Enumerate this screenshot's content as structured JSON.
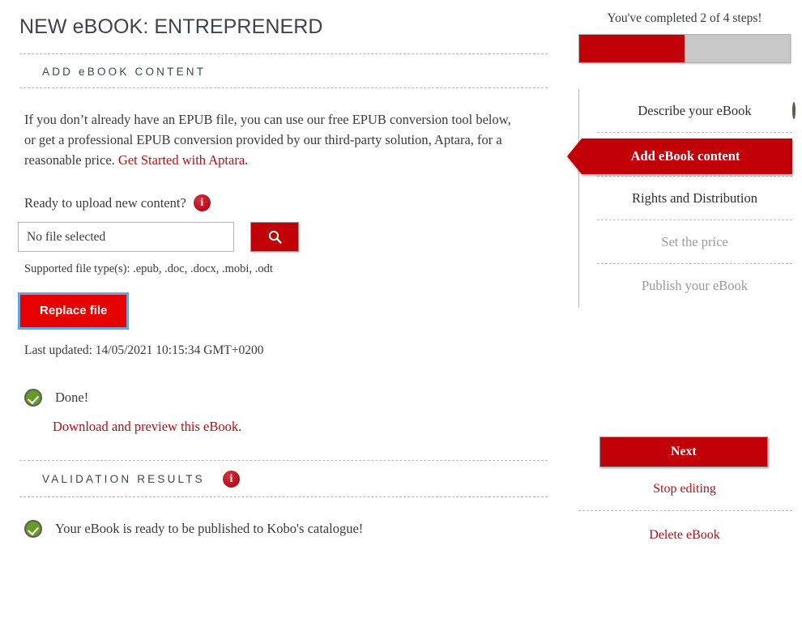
{
  "page": {
    "title": "NEW eBOOK: ENTREPRENERD"
  },
  "content_section": {
    "heading": "ADD eBOOK CONTENT",
    "intro_text_part1": "If you don’t already have an EPUB file, you can use our free EPUB conversion tool below, or get a professional EPUB conversion provided by our third-party solution, Aptara, for a reasonable price. ",
    "aptara_link": "Get Started with Aptara.",
    "upload_label": "Ready to upload new content?",
    "upload_info_icon": "info-icon",
    "file_input_value": "No file selected",
    "file_input_placeholder": "No file selected",
    "browse_icon": "search-icon",
    "supported_types": "Supported file type(s): .epub, .doc, .docx, .mobi, .odt",
    "replace_file_label": "Replace file",
    "last_updated": "Last updated: 14/05/2021 10:15:34 GMT+0200",
    "done_icon": "green-check-icon",
    "done_label": "Done!",
    "download_link": "Download and preview this eBook."
  },
  "validation_section": {
    "heading": "VALIDATION RESULTS",
    "info_icon": "info-icon",
    "result_icon": "green-check-icon",
    "result_text": "Your eBook is ready to be published to Kobo's catalogue!"
  },
  "progress": {
    "caption": "You've completed 2 of 4 steps!",
    "completed": 2,
    "total": 4,
    "percent": 50,
    "fill_color": "#c20008",
    "track_color": "#c8c8c8"
  },
  "steps": [
    {
      "label": "Describe your eBook",
      "state": "done",
      "icon": "green-check-icon"
    },
    {
      "label": "Add eBook content",
      "state": "active",
      "icon": ""
    },
    {
      "label": "Rights and Distribution",
      "state": "todo",
      "icon": ""
    },
    {
      "label": "Set the price",
      "state": "disabled",
      "icon": ""
    },
    {
      "label": "Publish your eBook",
      "state": "disabled",
      "icon": ""
    }
  ],
  "actions": {
    "next_label": "Next",
    "stop_editing_label": "Stop editing",
    "delete_label": "Delete eBook"
  },
  "colors": {
    "brand_red": "#c20008",
    "bright_red": "#e60000",
    "link_red": "#b01116",
    "focus_blue": "#6ca3dd",
    "success_green": "#669b29"
  }
}
